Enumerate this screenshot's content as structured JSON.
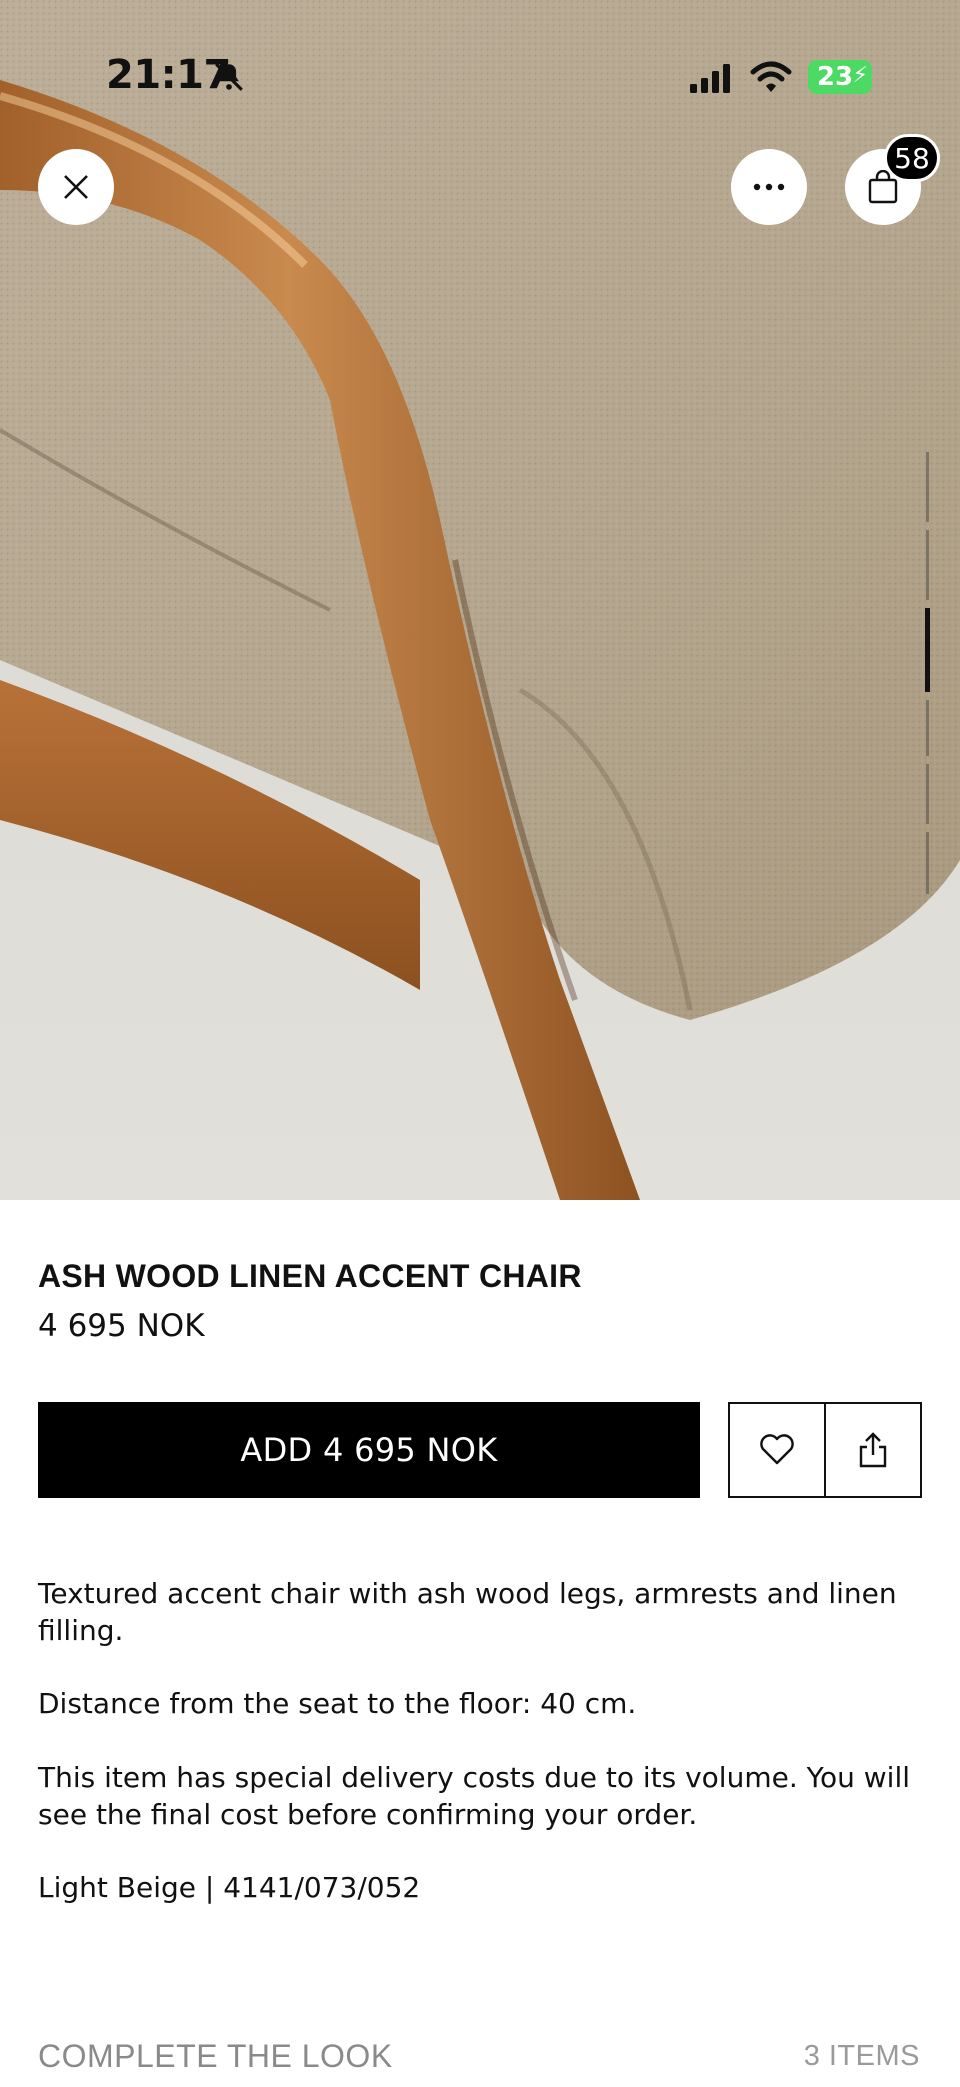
{
  "status_bar": {
    "time": "21:17",
    "battery": "23",
    "icons": [
      "bell-slash-icon",
      "cellular-signal-icon",
      "wifi-icon",
      "battery-charging-icon"
    ]
  },
  "header": {
    "close_icon": "close-icon",
    "more_icon": "ellipsis-icon",
    "bag_icon": "shopping-bag-icon",
    "bag_count": "58"
  },
  "gallery": {
    "image": "ash wood chair with beige linen seat (close-up)",
    "images_total": 6,
    "active_index": 3
  },
  "product": {
    "title": "ASH WOOD LINEN ACCENT CHAIR",
    "price": "4 695 NOK",
    "add_button_label": "ADD 4 695 NOK",
    "wishlist_icon": "heart-icon",
    "share_icon": "share-icon",
    "description": [
      "Textured accent chair with ash wood legs, armrests and linen filling.",
      "Distance from the seat to the floor: 40 cm.",
      "This item has special delivery costs due to its volume. You will see the final cost before confirming your order.",
      "Light Beige | 4141/073/052"
    ]
  },
  "complete_the_look": {
    "title": "COMPLETE THE LOOK",
    "count": "3 ITEMS"
  },
  "colors": {
    "primary_button": "#000000",
    "badge": "#000000",
    "battery": "#4cd964",
    "muted_text": "#8a8a8a"
  }
}
